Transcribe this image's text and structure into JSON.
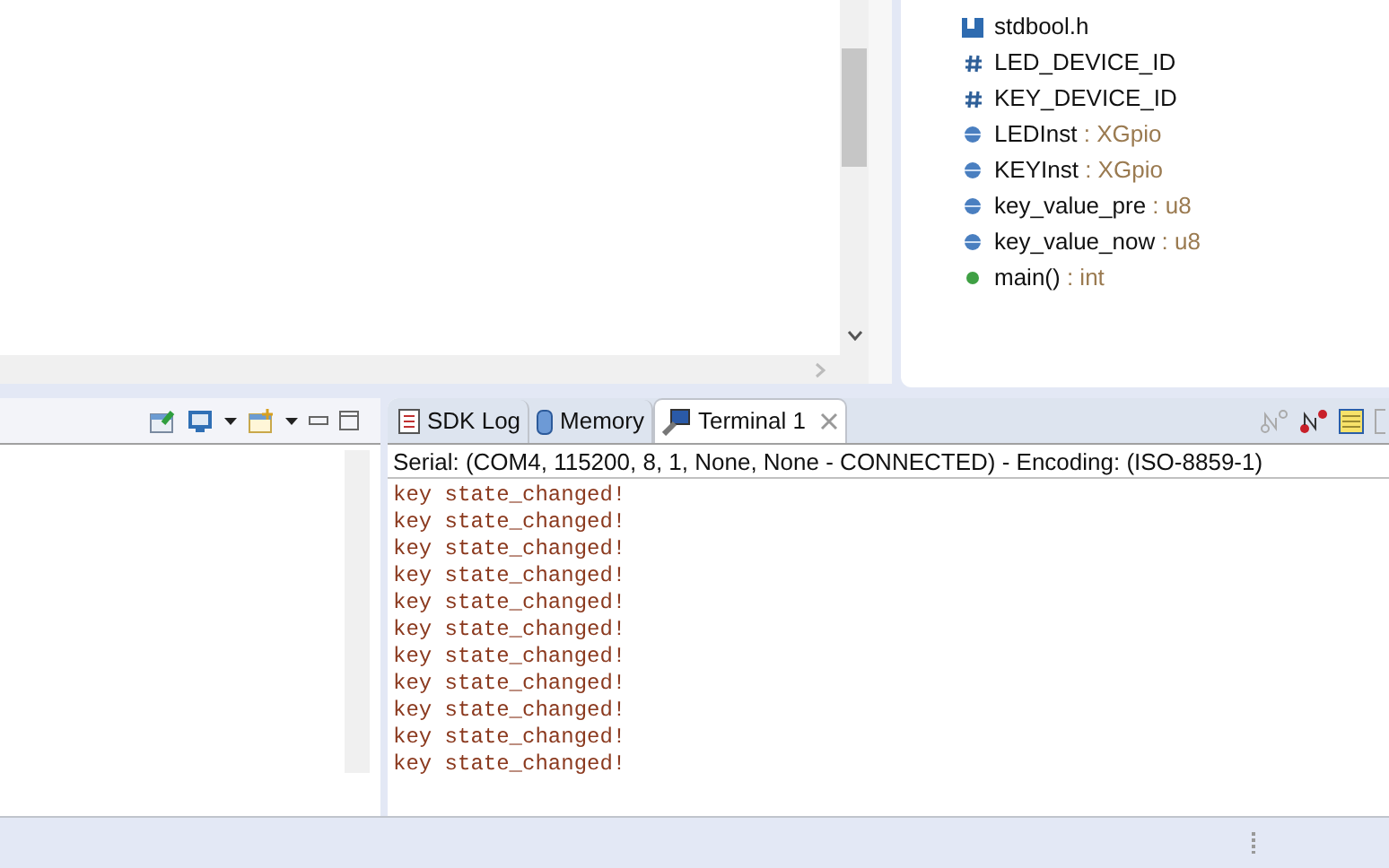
{
  "outline": [
    {
      "kind": "include",
      "name": "stdbool.h"
    },
    {
      "kind": "macro",
      "name": "LED_DEVICE_ID"
    },
    {
      "kind": "macro",
      "name": "KEY_DEVICE_ID"
    },
    {
      "kind": "field",
      "name": "LEDInst",
      "type": ": XGpio"
    },
    {
      "kind": "field",
      "name": "KEYInst",
      "type": ": XGpio"
    },
    {
      "kind": "field",
      "name": "key_value_pre",
      "type": ": u8"
    },
    {
      "kind": "field",
      "name": "key_value_now",
      "type": ": u8"
    },
    {
      "kind": "function",
      "name": "main()",
      "type": ": int"
    }
  ],
  "terminal": {
    "tabs": [
      {
        "kind": "log",
        "label": "SDK Log",
        "selected": false
      },
      {
        "kind": "memory",
        "label": "Memory",
        "selected": false
      },
      {
        "kind": "terminal",
        "label": "Terminal 1",
        "selected": true
      }
    ],
    "status": "Serial: (COM4, 115200, 8, 1, None, None - CONNECTED) - Encoding: (ISO-8859-1)",
    "lines": [
      "key state_changed!",
      "key state_changed!",
      "key state_changed!",
      "key state_changed!",
      "key state_changed!",
      "key state_changed!",
      "key state_changed!",
      "key state_changed!",
      "key state_changed!",
      "key state_changed!",
      "key state_changed!"
    ]
  }
}
